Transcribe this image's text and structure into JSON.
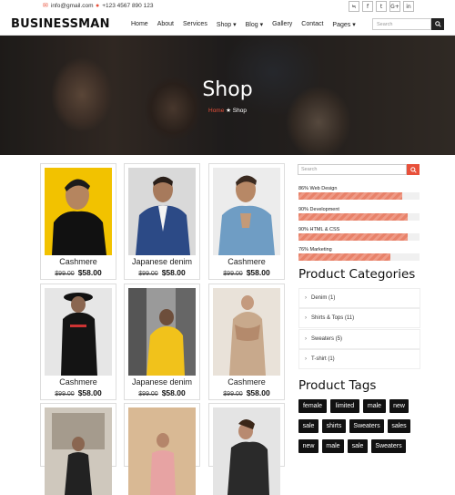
{
  "topbar": {
    "email": "info@gmail.com",
    "phone": "+123 4567 890 123",
    "email_icon": "envelope-icon",
    "phone_icon": "map-pin-icon",
    "social": [
      {
        "name": "rss-icon",
        "glyph": "ॐ"
      },
      {
        "name": "facebook-icon",
        "glyph": "f"
      },
      {
        "name": "twitter-icon",
        "glyph": "t"
      },
      {
        "name": "google-plus-icon",
        "glyph": "G+"
      },
      {
        "name": "linkedin-icon",
        "glyph": "in"
      }
    ]
  },
  "nav": {
    "brand": "BUSINESSMAN",
    "items": [
      "Home",
      "About",
      "Services",
      "Shop ▾",
      "Blog ▾",
      "Gallery",
      "Contact",
      "Pages ▾"
    ],
    "search_placeholder": "Search"
  },
  "hero": {
    "title": "Shop",
    "breadcrumb_home": "Home",
    "breadcrumb_sep": "★",
    "breadcrumb_current": "Shop"
  },
  "products": [
    {
      "name": "Cashmere",
      "old_price": "$99.00",
      "price": "$58.00"
    },
    {
      "name": "Japanese denim",
      "old_price": "$99.00",
      "price": "$58.00"
    },
    {
      "name": "Cashmere",
      "old_price": "$99.00",
      "price": "$58.00"
    },
    {
      "name": "Cashmere",
      "old_price": "$99.00",
      "price": "$58.00"
    },
    {
      "name": "Japanese denim",
      "old_price": "$99.00",
      "price": "$58.00"
    },
    {
      "name": "Cashmere",
      "old_price": "$99.00",
      "price": "$58.00"
    },
    {
      "name": "",
      "old_price": "",
      "price": ""
    },
    {
      "name": "",
      "old_price": "",
      "price": ""
    },
    {
      "name": "",
      "old_price": "",
      "price": ""
    }
  ],
  "sidebar": {
    "search_placeholder": "Search",
    "skills": [
      {
        "label": "86% Web Design",
        "value": 86
      },
      {
        "label": "90% Development",
        "value": 90
      },
      {
        "label": "90% HTML & CSS",
        "value": 90
      },
      {
        "label": "76% Marketing",
        "value": 76
      }
    ],
    "categories_title": "Product Categories",
    "categories": [
      "Denim (1)",
      "Shirts & Tops (11)",
      "Sweaters (5)",
      "T-shirt (1)"
    ],
    "tags_title": "Product Tags",
    "tags": [
      "female",
      "limited",
      "male",
      "new",
      "sale",
      "shirts",
      "Sweaters",
      "sales",
      "new",
      "male",
      "sale",
      "Sweaters"
    ]
  },
  "colors": {
    "accent": "#e8503a",
    "dark": "#111111"
  }
}
